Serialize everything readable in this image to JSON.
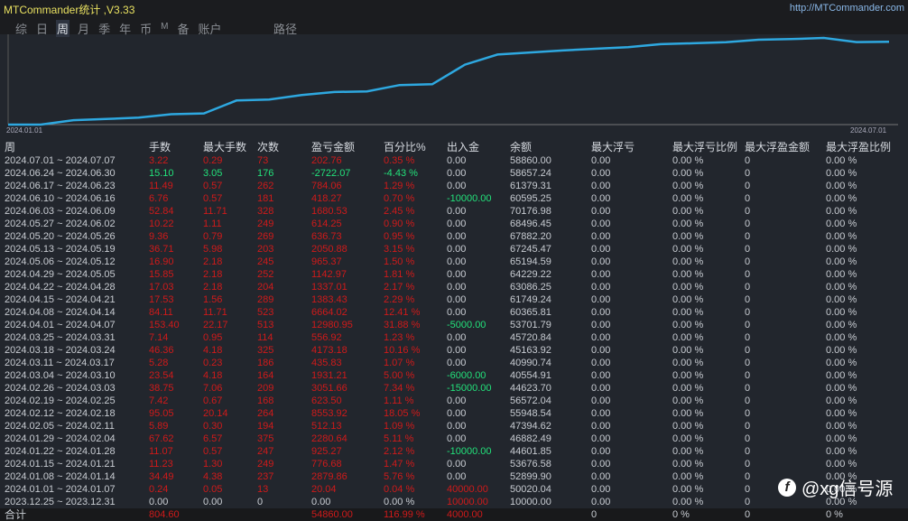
{
  "window": {
    "title": "MTCommander统计 ,V3.33",
    "link": "http://MTCommander.com"
  },
  "tabs": [
    {
      "label": "综"
    },
    {
      "label": "日"
    },
    {
      "label": "周",
      "active": true
    },
    {
      "label": "月"
    },
    {
      "label": "季"
    },
    {
      "label": "年"
    },
    {
      "label": "币"
    },
    {
      "label": "M"
    },
    {
      "label": "备"
    },
    {
      "label": "账户"
    }
  ],
  "path_tab": "路径",
  "chart": {
    "x_start": "2024.01.01",
    "x_end": "2024.07.01",
    "line_color": "#2ea8e0"
  },
  "columns": [
    "周",
    "手数",
    "最大手数",
    "次数",
    "盈亏金额",
    "百分比%",
    "出入金",
    "余额",
    "最大浮亏",
    "最大浮亏比例",
    "最大浮盈金额",
    "最大浮盈比例"
  ],
  "rows": [
    [
      "2024.07.01 ~ 2024.07.07",
      "3.22",
      "0.29",
      "73",
      "202.76",
      "0.35 %",
      "0.00",
      "58860.00",
      "0.00",
      "0.00 %",
      "0",
      "0.00 %"
    ],
    [
      "2024.06.24 ~ 2024.06.30",
      "15.10",
      "3.05",
      "176",
      "-2722.07",
      "-4.43 %",
      "0.00",
      "58657.24",
      "0.00",
      "0.00 %",
      "0",
      "0.00 %"
    ],
    [
      "2024.06.17 ~ 2024.06.23",
      "11.49",
      "0.57",
      "262",
      "784.06",
      "1.29 %",
      "0.00",
      "61379.31",
      "0.00",
      "0.00 %",
      "0",
      "0.00 %"
    ],
    [
      "2024.06.10 ~ 2024.06.16",
      "6.76",
      "0.57",
      "181",
      "418.27",
      "0.70 %",
      "-10000.00",
      "60595.25",
      "0.00",
      "0.00 %",
      "0",
      "0.00 %"
    ],
    [
      "2024.06.03 ~ 2024.06.09",
      "52.84",
      "11.71",
      "328",
      "1680.53",
      "2.45 %",
      "0.00",
      "70176.98",
      "0.00",
      "0.00 %",
      "0",
      "0.00 %"
    ],
    [
      "2024.05.27 ~ 2024.06.02",
      "10.22",
      "1.11",
      "249",
      "614.25",
      "0.90 %",
      "0.00",
      "68496.45",
      "0.00",
      "0.00 %",
      "0",
      "0.00 %"
    ],
    [
      "2024.05.20 ~ 2024.05.26",
      "9.36",
      "0.79",
      "269",
      "636.73",
      "0.95 %",
      "0.00",
      "67882.20",
      "0.00",
      "0.00 %",
      "0",
      "0.00 %"
    ],
    [
      "2024.05.13 ~ 2024.05.19",
      "36.71",
      "5.98",
      "203",
      "2050.88",
      "3.15 %",
      "0.00",
      "67245.47",
      "0.00",
      "0.00 %",
      "0",
      "0.00 %"
    ],
    [
      "2024.05.06 ~ 2024.05.12",
      "16.90",
      "2.18",
      "245",
      "965.37",
      "1.50 %",
      "0.00",
      "65194.59",
      "0.00",
      "0.00 %",
      "0",
      "0.00 %"
    ],
    [
      "2024.04.29 ~ 2024.05.05",
      "15.85",
      "2.18",
      "252",
      "1142.97",
      "1.81 %",
      "0.00",
      "64229.22",
      "0.00",
      "0.00 %",
      "0",
      "0.00 %"
    ],
    [
      "2024.04.22 ~ 2024.04.28",
      "17.03",
      "2.18",
      "204",
      "1337.01",
      "2.17 %",
      "0.00",
      "63086.25",
      "0.00",
      "0.00 %",
      "0",
      "0.00 %"
    ],
    [
      "2024.04.15 ~ 2024.04.21",
      "17.53",
      "1.56",
      "289",
      "1383.43",
      "2.29 %",
      "0.00",
      "61749.24",
      "0.00",
      "0.00 %",
      "0",
      "0.00 %"
    ],
    [
      "2024.04.08 ~ 2024.04.14",
      "84.11",
      "11.71",
      "523",
      "6664.02",
      "12.41 %",
      "0.00",
      "60365.81",
      "0.00",
      "0.00 %",
      "0",
      "0.00 %"
    ],
    [
      "2024.04.01 ~ 2024.04.07",
      "153.40",
      "22.17",
      "513",
      "12980.95",
      "31.88 %",
      "-5000.00",
      "53701.79",
      "0.00",
      "0.00 %",
      "0",
      "0.00 %"
    ],
    [
      "2024.03.25 ~ 2024.03.31",
      "7.14",
      "0.95",
      "114",
      "556.92",
      "1.23 %",
      "0.00",
      "45720.84",
      "0.00",
      "0.00 %",
      "0",
      "0.00 %"
    ],
    [
      "2024.03.18 ~ 2024.03.24",
      "46.36",
      "4.18",
      "325",
      "4173.18",
      "10.16 %",
      "0.00",
      "45163.92",
      "0.00",
      "0.00 %",
      "0",
      "0.00 %"
    ],
    [
      "2024.03.11 ~ 2024.03.17",
      "5.28",
      "0.23",
      "186",
      "435.83",
      "1.07 %",
      "0.00",
      "40990.74",
      "0.00",
      "0.00 %",
      "0",
      "0.00 %"
    ],
    [
      "2024.03.04 ~ 2024.03.10",
      "23.54",
      "4.18",
      "164",
      "1931.21",
      "5.00 %",
      "-6000.00",
      "40554.91",
      "0.00",
      "0.00 %",
      "0",
      "0.00 %"
    ],
    [
      "2024.02.26 ~ 2024.03.03",
      "38.75",
      "7.06",
      "209",
      "3051.66",
      "7.34 %",
      "-15000.00",
      "44623.70",
      "0.00",
      "0.00 %",
      "0",
      "0.00 %"
    ],
    [
      "2024.02.19 ~ 2024.02.25",
      "7.42",
      "0.67",
      "168",
      "623.50",
      "1.11 %",
      "0.00",
      "56572.04",
      "0.00",
      "0.00 %",
      "0",
      "0.00 %"
    ],
    [
      "2024.02.12 ~ 2024.02.18",
      "95.05",
      "20.14",
      "264",
      "8553.92",
      "18.05 %",
      "0.00",
      "55948.54",
      "0.00",
      "0.00 %",
      "0",
      "0.00 %"
    ],
    [
      "2024.02.05 ~ 2024.02.11",
      "5.89",
      "0.30",
      "194",
      "512.13",
      "1.09 %",
      "0.00",
      "47394.62",
      "0.00",
      "0.00 %",
      "0",
      "0.00 %"
    ],
    [
      "2024.01.29 ~ 2024.02.04",
      "67.62",
      "6.57",
      "375",
      "2280.64",
      "5.11 %",
      "0.00",
      "46882.49",
      "0.00",
      "0.00 %",
      "0",
      "0.00 %"
    ],
    [
      "2024.01.22 ~ 2024.01.28",
      "11.07",
      "0.57",
      "247",
      "925.27",
      "2.12 %",
      "-10000.00",
      "44601.85",
      "0.00",
      "0.00 %",
      "0",
      "0.00 %"
    ],
    [
      "2024.01.15 ~ 2024.01.21",
      "11.23",
      "1.30",
      "249",
      "776.68",
      "1.47 %",
      "0.00",
      "53676.58",
      "0.00",
      "0.00 %",
      "0",
      "0.00 %"
    ],
    [
      "2024.01.08 ~ 2024.01.14",
      "34.49",
      "4.38",
      "237",
      "2879.86",
      "5.76 %",
      "0.00",
      "52899.90",
      "0.00",
      "0.00 %",
      "0",
      "0.00 %"
    ],
    [
      "2024.01.01 ~ 2024.01.07",
      "0.24",
      "0.05",
      "13",
      "20.04",
      "0.04 %",
      "40000.00",
      "50020.04",
      "0.00",
      "0.00 %",
      "0",
      "0.00 %"
    ],
    [
      "2023.12.25 ~ 2023.12.31",
      "0.00",
      "0.00",
      "0",
      "0.00",
      "0.00 %",
      "10000.00",
      "10000.00",
      "0.00",
      "0.00 %",
      "0",
      "0.00 %"
    ]
  ],
  "total": [
    "合计",
    "804.60",
    "",
    "",
    "54860.00",
    "116.99 %",
    "4000.00",
    "",
    "0",
    "0 %",
    "0",
    "0 %"
  ],
  "watermark": "@xg信号源",
  "colors": {
    "profit": "#d01a1a",
    "loss": "#22e07a"
  }
}
